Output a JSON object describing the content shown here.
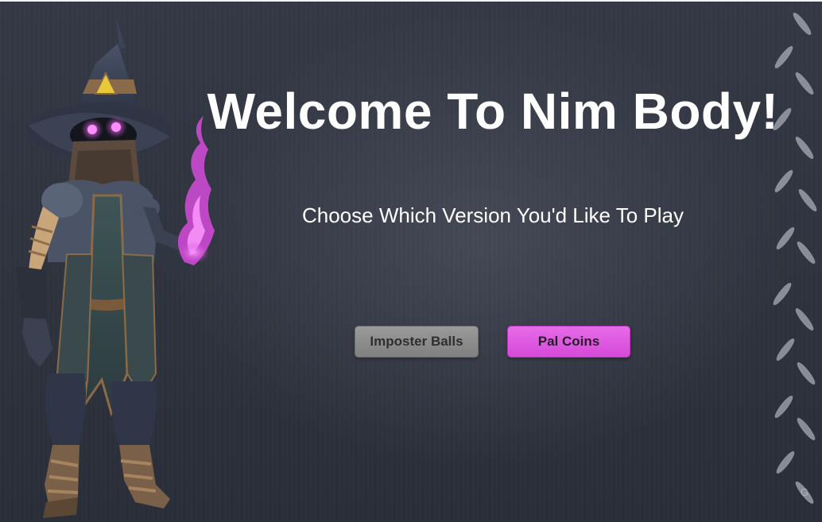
{
  "screen": {
    "title": "Welcome To Nim Body!",
    "subtitle": "Choose Which Version You'd Like To Play"
  },
  "buttons": {
    "imposter_balls": "Imposter Balls",
    "pal_coins": "Pal Coins"
  },
  "watermark": "G",
  "colors": {
    "background": "#30343f",
    "title_text": "#ffffff",
    "imposter_button": "#8c8c8c",
    "pal_coins_button": "#dd58df",
    "magic_flame": "#d64bdc",
    "wizard_eyes": "#ff66ff"
  },
  "icons": {
    "character": "wizard-character-illustration",
    "decoration": "chain-link-decoration"
  }
}
